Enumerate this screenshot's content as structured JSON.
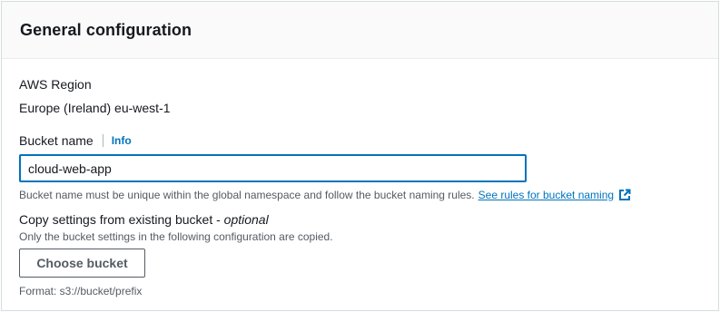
{
  "panel": {
    "title": "General configuration"
  },
  "region": {
    "label": "AWS Region",
    "value": "Europe (Ireland) eu-west-1"
  },
  "bucket_name": {
    "label": "Bucket name",
    "info_link": "Info",
    "value": "cloud-web-app",
    "hint": "Bucket name must be unique within the global namespace and follow the bucket naming rules.",
    "hint_link": "See rules for bucket naming",
    "hint_link_icon": "external-link-icon"
  },
  "copy_settings": {
    "label_main": "Copy settings from existing bucket - ",
    "label_optional": "optional",
    "description": "Only the bucket settings in the following configuration are copied.",
    "button_label": "Choose bucket",
    "format_hint": "Format: s3://bucket/prefix"
  },
  "colors": {
    "link": "#0073bb",
    "focus_border": "#0073bb",
    "header_bg": "#fafafa",
    "secondary_text": "#545b64"
  }
}
